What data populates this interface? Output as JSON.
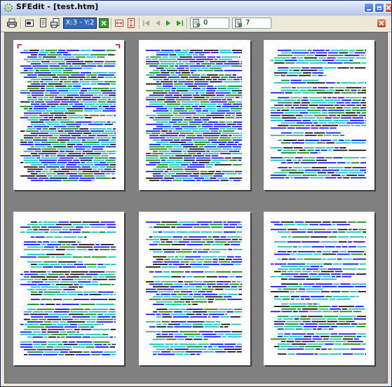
{
  "window": {
    "title": "SFEdit - [test.htm]"
  },
  "toolbar": {
    "position_readout": "X:3 - Y:2",
    "page_field_value": "0",
    "pages_field_value": "7",
    "icons": [
      "print-icon",
      "single-page-icon",
      "two-page-icon",
      "print-setup-icon",
      "zoom-in-icon",
      "page-width-icon",
      "page-height-icon",
      "first-page-icon",
      "previous-page-icon",
      "next-page-icon",
      "last-page-icon",
      "current-page-icon",
      "page-count-icon",
      "close-preview-icon"
    ]
  },
  "preview": {
    "pages": [
      {
        "label": "page-1"
      },
      {
        "label": "page-2"
      },
      {
        "label": "page-3"
      },
      {
        "label": "page-4"
      },
      {
        "label": "page-5"
      },
      {
        "label": "page-6"
      }
    ]
  },
  "colors": {
    "accent": "#316ac5",
    "preview_background": "#808080",
    "code_blue": "#0000ff",
    "code_cyan": "#00b8b8",
    "code_green": "#008000",
    "code_red": "#ff0000",
    "code_black": "#000000"
  }
}
